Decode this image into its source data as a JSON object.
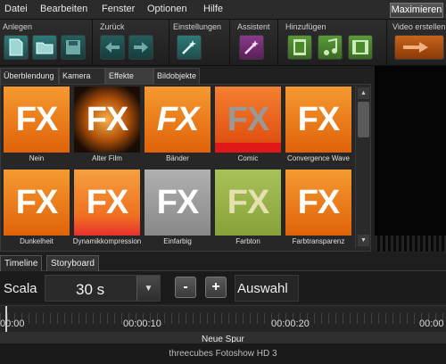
{
  "menu": [
    "Datei",
    "Bearbeiten",
    "Fenster",
    "Optionen",
    "Hilfe"
  ],
  "maximize_label": "Maximieren",
  "toolbar": {
    "groups": [
      {
        "label": "Anlegen"
      },
      {
        "label": "Zurück"
      },
      {
        "label": "Einstellungen"
      },
      {
        "label": "Assistent"
      },
      {
        "label": "Hinzufügen"
      },
      {
        "label": "Video erstellen"
      }
    ]
  },
  "effect_tabs": [
    "Überblendung",
    "Kamera",
    "Effekte",
    "Bildobjekte"
  ],
  "active_tab": "Effekte",
  "effects": [
    {
      "name": "Nein",
      "text": "FX",
      "style": "orange"
    },
    {
      "name": "Alter Film",
      "text": "FX",
      "style": "oldfilm"
    },
    {
      "name": "Bänder",
      "text": "FX",
      "style": "bands"
    },
    {
      "name": "Comic",
      "text": "FX",
      "style": "comic"
    },
    {
      "name": "Convergence Wave",
      "text": "FX",
      "style": "orange"
    },
    {
      "name": "Dunkelheit",
      "text": "FX",
      "style": "orange"
    },
    {
      "name": "Dynamikkompression",
      "text": "FX",
      "style": "dynamic"
    },
    {
      "name": "Einfarbig",
      "text": "FX",
      "style": "gray"
    },
    {
      "name": "Farbton",
      "text": "FX",
      "style": "olive"
    },
    {
      "name": "Farbtransparenz",
      "text": "FX",
      "style": "orange"
    }
  ],
  "lower_tabs": [
    "Timeline",
    "Storyboard"
  ],
  "active_lower_tab": "Storyboard",
  "controls": {
    "scala_label": "Scala",
    "duration": "30 s",
    "minus": "-",
    "plus": "+",
    "auswahl": "Auswahl"
  },
  "timeline": {
    "ticks": [
      "00:00",
      "00:00:10",
      "00:00:20",
      "00:00"
    ],
    "track_label": "Neue Spur"
  },
  "status": "threecubes Fotoshow HD 3",
  "colors": {
    "fx_orange": "#f07a10",
    "fx_gray": "#9a9a9a",
    "fx_olive": "#9ab44a",
    "fx_comic": "#f06410"
  }
}
